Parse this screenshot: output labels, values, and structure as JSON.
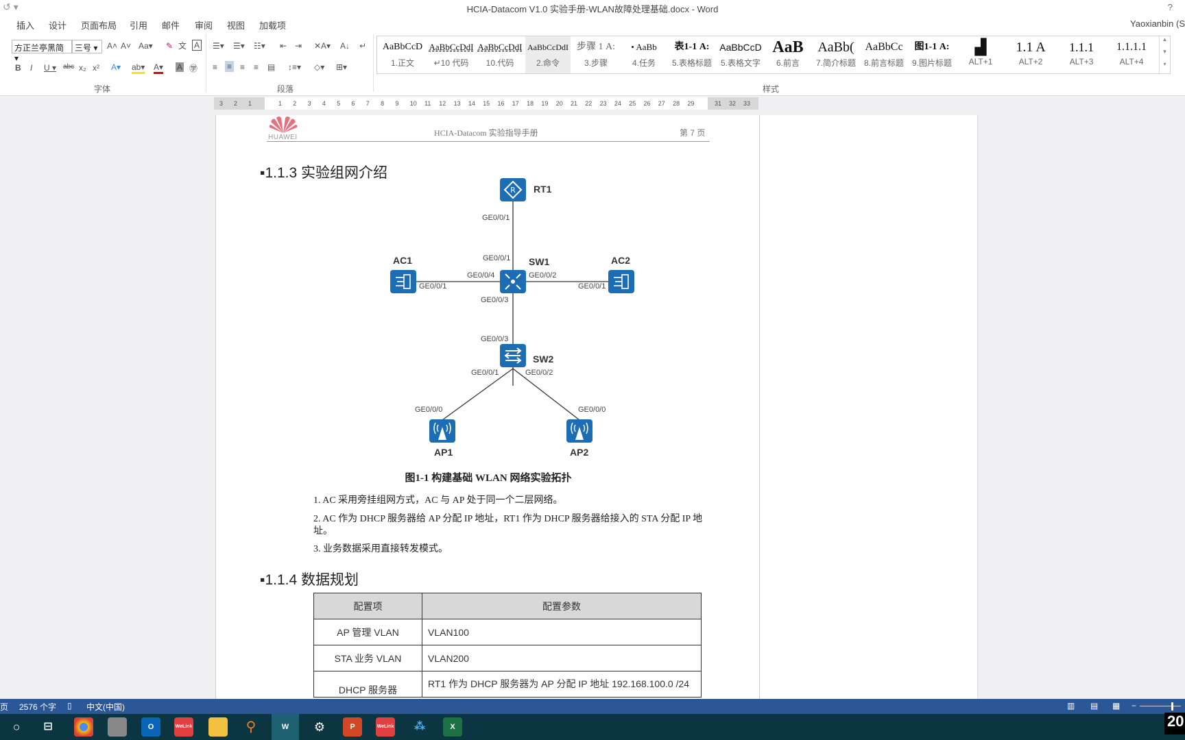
{
  "window": {
    "title": "HCIA-Datacom V1.0 实验手册-WLAN故障处理基础.docx - Word",
    "help": "?",
    "user": "Yaoxianbin (S"
  },
  "menu": {
    "tabs": [
      "插入",
      "设计",
      "页面布局",
      "引用",
      "邮件",
      "审阅",
      "视图",
      "加载项"
    ]
  },
  "ribbon": {
    "font_name": "方正兰亭黑简",
    "font_size": "三号",
    "group_font": "字体",
    "group_paragraph": "段落",
    "group_styles": "样式",
    "styles": [
      {
        "preview": "AaBbCcD",
        "name": "1.正文"
      },
      {
        "preview": "AaBbCcDdI",
        "name": "↵10 代码"
      },
      {
        "preview": "AaBbCcDdI",
        "name": "10.代码"
      },
      {
        "preview": "AaBbCcDdI",
        "name": "2.命令"
      },
      {
        "preview": "步骤 1  A:",
        "name": "3.步骤"
      },
      {
        "preview": "•    AaBb",
        "name": "4.任务"
      },
      {
        "preview": "表1-1  A:",
        "name": "5.表格标题"
      },
      {
        "preview": "AaBbCcD",
        "name": "5.表格文字"
      },
      {
        "preview": "AaB",
        "name": "6.前言"
      },
      {
        "preview": "AaBb(",
        "name": "7.简介标题"
      },
      {
        "preview": "AaBbCc",
        "name": "8.前言标题"
      },
      {
        "preview": "图1-1  A:",
        "name": "9.图片标题"
      },
      {
        "preview": "▟",
        "name": "ALT+1"
      },
      {
        "preview": "1.1  A",
        "name": "ALT+2"
      },
      {
        "preview": "1.1.1",
        "name": "ALT+3"
      },
      {
        "preview": "1.1.1.1",
        "name": "ALT+4"
      }
    ]
  },
  "ruler": {
    "left_numbers": [
      "3",
      "2",
      "1"
    ],
    "numbers": [
      "1",
      "2",
      "3",
      "4",
      "5",
      "6",
      "7",
      "8",
      "9",
      "10",
      "11",
      "12",
      "13",
      "14",
      "15",
      "16",
      "17",
      "18",
      "19",
      "20",
      "21",
      "22",
      "23",
      "24",
      "25",
      "26",
      "27",
      "28",
      "29"
    ],
    "right_numbers": [
      "31",
      "32",
      "33"
    ]
  },
  "document": {
    "header_logo": "HUAWEI",
    "header_text": "HCIA-Datacom 实验指导手册",
    "header_page": "第 7 页",
    "section1": "1.1.3 实验组网介绍",
    "topology": {
      "nodes": {
        "rt1": "RT1",
        "sw1": "SW1",
        "sw2": "SW2",
        "ac1": "AC1",
        "ac2": "AC2",
        "ap1": "AP1",
        "ap2": "AP2"
      },
      "ports": {
        "rt1_down": "GE0/0/1",
        "sw1_up": "GE0/0/1",
        "sw1_left": "GE0/0/4",
        "sw1_right": "GE0/0/2",
        "sw1_down": "GE0/0/3",
        "ac1_right": "GE0/0/1",
        "ac2_left": "GE0/0/1",
        "sw2_up": "GE0/0/3",
        "sw2_left": "GE0/0/1",
        "sw2_right": "GE0/0/2",
        "ap1_up": "GE0/0/0",
        "ap2_up": "GE0/0/0"
      }
    },
    "caption": "图1-1  构建基础 WLAN 网络实验拓扑",
    "points": [
      "1. AC 采用旁挂组网方式，AC 与 AP 处于同一个二层网络。",
      "2. AC 作为 DHCP 服务器给 AP 分配 IP 地址，RT1 作为 DHCP 服务器给接入的 STA 分配 IP 地",
      "址。",
      "3.  业务数据采用直接转发模式。"
    ],
    "section2": "1.1.4 数据规划",
    "table": {
      "headers": [
        "配置项",
        "配置参数"
      ],
      "rows": [
        [
          "AP 管理 VLAN",
          "VLAN100"
        ],
        [
          "STA 业务 VLAN",
          "VLAN200"
        ],
        [
          "DHCP 服务器",
          "RT1 作为 DHCP 服务器为 AP 分配 IP 地址 192.168.100.0 /24"
        ]
      ]
    }
  },
  "status": {
    "page": "页",
    "words": "2576 个字",
    "language": "中文(中国)"
  },
  "taskbar": {
    "clock": "20"
  }
}
